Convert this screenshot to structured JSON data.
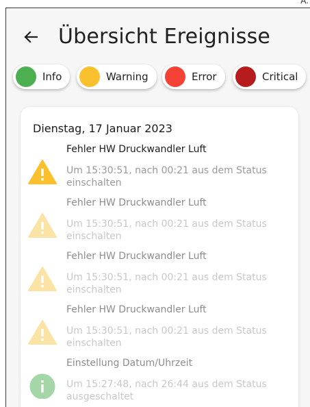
{
  "corner": {
    "text": "A."
  },
  "header": {
    "title": "Übersicht Ereignisse",
    "back_icon": "arrow-left-icon"
  },
  "filters": [
    {
      "label": "Info",
      "color": "#4CAF50"
    },
    {
      "label": "Warning",
      "color": "#FBC02D"
    },
    {
      "label": "Error",
      "color": "#F44336"
    },
    {
      "label": "Critical",
      "color": "#B71C1C"
    }
  ],
  "card": {
    "date": "Dienstag, 17 Januar 2023",
    "events": [
      {
        "type": "warning",
        "icon": "warning-triangle-icon",
        "icon_color": "#FBC02D",
        "title": "Fehler HW Druckwandler Luft",
        "description": "Um 15:30:51, nach 00:21 aus dem Status einschalten"
      },
      {
        "type": "warning",
        "icon": "warning-triangle-icon",
        "icon_color": "#FBE3A6",
        "title": "Fehler HW Druckwandler Luft",
        "description": "Um 15:30:51, nach 00:21 aus dem Status einschalten"
      },
      {
        "type": "warning",
        "icon": "warning-triangle-icon",
        "icon_color": "#FBE3A6",
        "title": "Fehler HW Druckwandler Luft",
        "description": "Um 15:30:51, nach 00:21 aus dem Status einschalten"
      },
      {
        "type": "warning",
        "icon": "warning-triangle-icon",
        "icon_color": "#FBE3A6",
        "title": "Fehler HW Druckwandler Luft",
        "description": "Um 15:30:51, nach 00:21 aus dem Status einschalten"
      },
      {
        "type": "info",
        "icon": "info-circle-icon",
        "icon_color": "#A5D6A7",
        "title": "Einstellung Datum/Uhrzeit",
        "description": "Um 15:27:48, nach 26:44 aus dem Status ausgeschaltet"
      }
    ]
  }
}
